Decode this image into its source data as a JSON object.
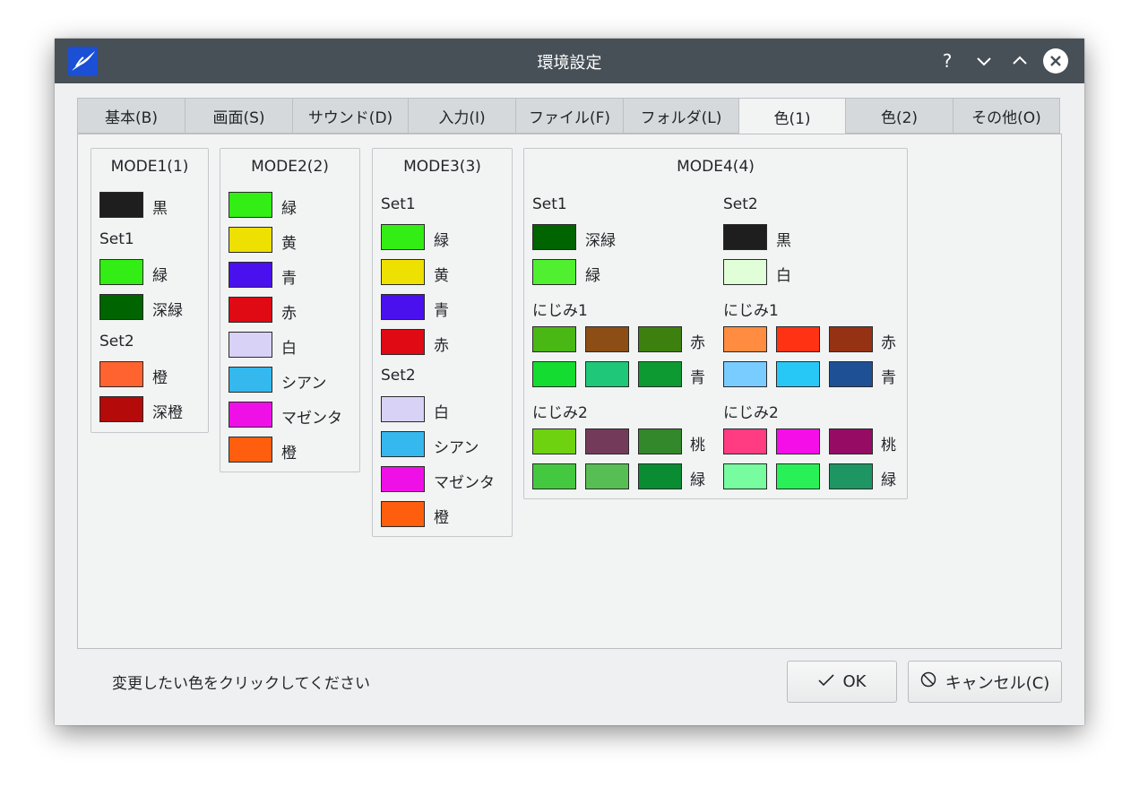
{
  "window": {
    "title": "環境設定"
  },
  "titlebar": {
    "help": "?",
    "minimize": "⌄",
    "maximize": "⌃",
    "close": "✕"
  },
  "tabs": [
    "基本(B)",
    "画面(S)",
    "サウンド(D)",
    "入力(I)",
    "ファイル(F)",
    "フォルダ(L)",
    "色(1)",
    "色(2)",
    "その他(O)"
  ],
  "active_tab": "色(1)",
  "mode1": {
    "title": "MODE1(1)",
    "top": [
      {
        "color": "#1e1e1e",
        "label": "黒"
      }
    ],
    "set1_label": "Set1",
    "set1": [
      {
        "color": "#33ee14",
        "label": "緑"
      },
      {
        "color": "#006400",
        "label": "深緑"
      }
    ],
    "set2_label": "Set2",
    "set2": [
      {
        "color": "#ff6430",
        "label": "橙"
      },
      {
        "color": "#b40a0a",
        "label": "深橙"
      }
    ]
  },
  "mode2": {
    "title": "MODE2(2)",
    "items": [
      {
        "color": "#33ee14",
        "label": "緑"
      },
      {
        "color": "#eee000",
        "label": "黄"
      },
      {
        "color": "#4a10ee",
        "label": "青"
      },
      {
        "color": "#e00a14",
        "label": "赤"
      },
      {
        "color": "#d8d2f6",
        "label": "白"
      },
      {
        "color": "#34b8ee",
        "label": "シアン"
      },
      {
        "color": "#ef10e8",
        "label": "マゼンタ"
      },
      {
        "color": "#ff5e0e",
        "label": "橙"
      }
    ]
  },
  "mode3": {
    "title": "MODE3(3)",
    "set1_label": "Set1",
    "set1": [
      {
        "color": "#33ee14",
        "label": "緑"
      },
      {
        "color": "#eee000",
        "label": "黄"
      },
      {
        "color": "#4a10ee",
        "label": "青"
      },
      {
        "color": "#e00a14",
        "label": "赤"
      }
    ],
    "set2_label": "Set2",
    "set2": [
      {
        "color": "#d8d2f6",
        "label": "白"
      },
      {
        "color": "#34b8ee",
        "label": "シアン"
      },
      {
        "color": "#ef10e8",
        "label": "マゼンタ"
      },
      {
        "color": "#ff5e0e",
        "label": "橙"
      }
    ]
  },
  "mode4": {
    "title": "MODE4(4)",
    "set1": {
      "label": "Set1",
      "items": [
        {
          "color": "#006400",
          "label": "深緑"
        },
        {
          "color": "#50f030",
          "label": "緑"
        }
      ],
      "nijimi1_label": "にじみ1",
      "nijimi1": [
        {
          "colors": [
            "#4ab814",
            "#8c4e14",
            "#3e8010"
          ],
          "label": "赤"
        },
        {
          "colors": [
            "#14dc30",
            "#1ec878",
            "#0e9a32"
          ],
          "label": "青"
        }
      ],
      "nijimi2_label": "にじみ2",
      "nijimi2": [
        {
          "colors": [
            "#6ed210",
            "#743a5a",
            "#32882a"
          ],
          "label": "桃"
        },
        {
          "colors": [
            "#44c840",
            "#56be52",
            "#0a8c32"
          ],
          "label": "緑"
        }
      ]
    },
    "set2": {
      "label": "Set2",
      "items": [
        {
          "color": "#1e1e1e",
          "label": "黒"
        },
        {
          "color": "#e0ffd8",
          "label": "白"
        }
      ],
      "nijimi1_label": "にじみ1",
      "nijimi1": [
        {
          "colors": [
            "#ff8c40",
            "#ff3214",
            "#963214"
          ],
          "label": "赤"
        },
        {
          "colors": [
            "#78ccff",
            "#28c8f6",
            "#1e5096"
          ],
          "label": "青"
        }
      ],
      "nijimi2_label": "にじみ2",
      "nijimi2": [
        {
          "colors": [
            "#ff3c82",
            "#f60ee8",
            "#960c64"
          ],
          "label": "桃"
        },
        {
          "colors": [
            "#78fca0",
            "#28f056",
            "#1e9664"
          ],
          "label": "緑"
        }
      ]
    }
  },
  "status_text": "変更したい色をクリックしてください",
  "buttons": {
    "ok": "OK",
    "ok_icon": "✓",
    "cancel": "キャンセル(C)",
    "cancel_icon": "⃠"
  }
}
